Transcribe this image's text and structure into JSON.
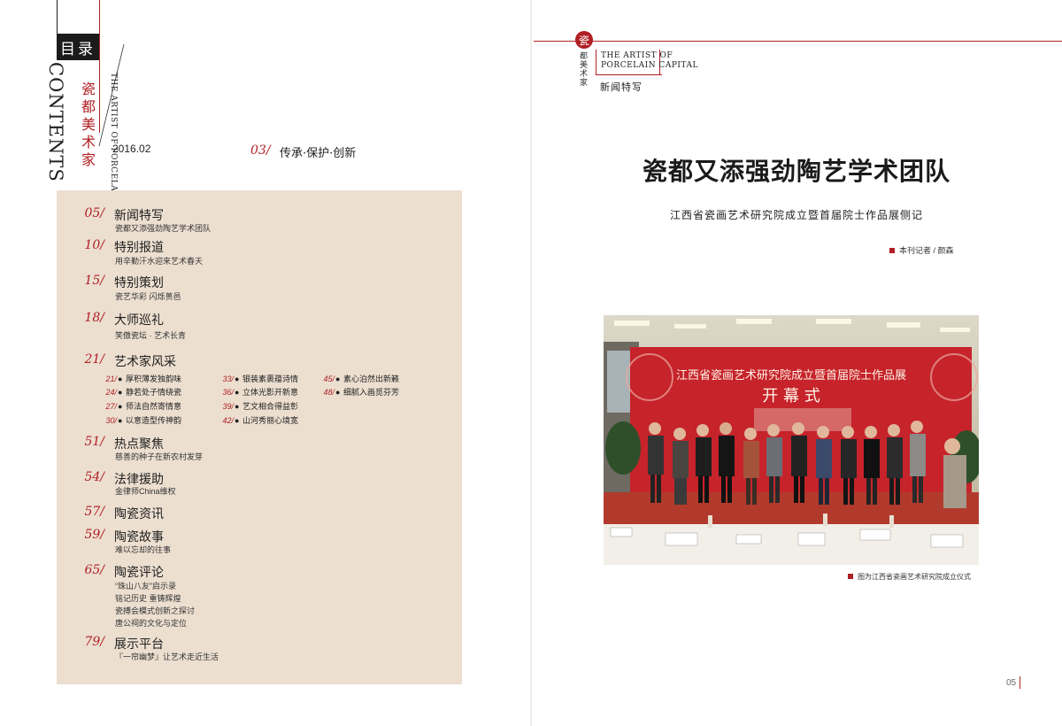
{
  "left_page": {
    "mulu": "目录",
    "contents_en": "CONTENTS",
    "magazine_cn": "瓷都美术家",
    "magazine_en": "THE ARTIST OF PORCELAIN CAPITAL",
    "issue": "2016.02",
    "lead": {
      "num": "03/",
      "title": "传承·保护·创新"
    },
    "toc": [
      {
        "num": "05/",
        "title": "新闻特写",
        "subs": [
          "瓷都又添强劲陶艺学术团队"
        ]
      },
      {
        "num": "10/",
        "title": "特别报道",
        "subs": [
          "用辛勤汗水迎来艺术春天"
        ]
      },
      {
        "num": "15/",
        "title": "特别策划",
        "subs": [
          "瓷艺华彩 闪烁蒉邑"
        ]
      },
      {
        "num": "18/",
        "title": "大师巡礼",
        "subs": [
          "笑傲瓷坛 · 艺术长青"
        ]
      },
      {
        "num": "21/",
        "title": "艺术家风采",
        "subs": []
      },
      {
        "num": "51/",
        "title": "热点聚焦",
        "subs": [
          "慈善的种子在新农村发芽"
        ]
      },
      {
        "num": "54/",
        "title": "法律援助",
        "subs": [
          "金律师China维权"
        ]
      },
      {
        "num": "57/",
        "title": "陶瓷资讯",
        "subs": []
      },
      {
        "num": "59/",
        "title": "陶瓷故事",
        "subs": [
          "难以忘却的往事"
        ]
      },
      {
        "num": "65/",
        "title": "陶瓷评论",
        "subs": [
          "“珠山八友”启示录",
          "铭记历史 重铸辉煌",
          "瓷搏会模式创新之探讨",
          "唐公祠的文化与定位"
        ]
      },
      {
        "num": "79/",
        "title": "展示平台",
        "subs": [
          "『一帘幽梦』让艺术走近生活"
        ]
      }
    ],
    "artist_columns": [
      [
        {
          "num": "21/",
          "text": "厚积薄发独韵味"
        },
        {
          "num": "24/",
          "text": "静若处子情绕瓷"
        },
        {
          "num": "27/",
          "text": "师法自然寄情意"
        },
        {
          "num": "30/",
          "text": "以意造型传神韵"
        }
      ],
      [
        {
          "num": "33/",
          "text": "银装素裹蕴诗情"
        },
        {
          "num": "36/",
          "text": "立体光影开新意"
        },
        {
          "num": "39/",
          "text": "艺文相合得益彰"
        },
        {
          "num": "42/",
          "text": "山河秀丽心境宽"
        }
      ],
      [
        {
          "num": "45/",
          "text": "素心泊然出新籁"
        },
        {
          "num": "48/",
          "text": "细腻入画觅芬芳"
        }
      ]
    ]
  },
  "right_page": {
    "seal": "瓷",
    "seal_sub": "都美术家",
    "header_en_line1": "THE ARTIST OF",
    "header_en_line2": "PORCELAIN CAPITAL",
    "section": "新闻特写",
    "title": "瓷都又添强劲陶艺学术团队",
    "subtitle": "江西省瓷画艺术研究院成立暨首届院士作品展侧记",
    "byline": "本刊记者 / 颜森",
    "photo": {
      "banner_line": "江西省瓷画艺术研究院成立暨首届院士作品展",
      "banner_main": "开 幕 式"
    },
    "caption": "图为江西省瓷画艺术研究院成立仪式",
    "page_number": "05"
  },
  "colors": {
    "accent": "#b01f24",
    "panel": "#ecdfd0"
  }
}
